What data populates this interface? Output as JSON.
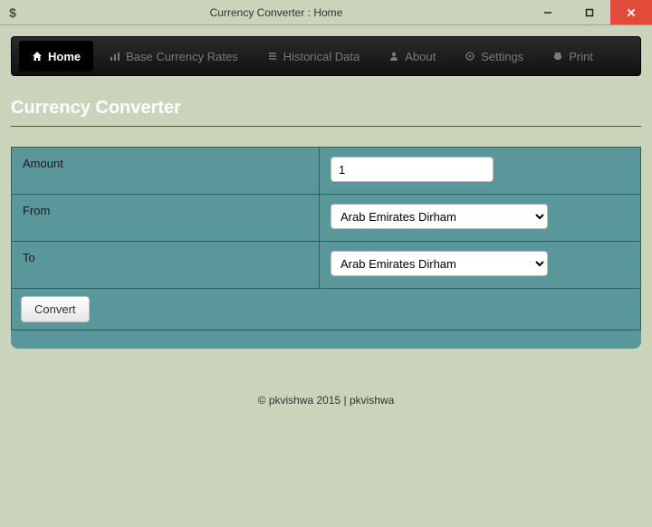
{
  "window": {
    "app_icon": "$",
    "title": "Currency Converter : Home"
  },
  "nav": {
    "items": [
      {
        "label": "Home",
        "active": true
      },
      {
        "label": "Base Currency Rates",
        "active": false
      },
      {
        "label": "Historical Data",
        "active": false
      },
      {
        "label": "About",
        "active": false
      },
      {
        "label": "Settings",
        "active": false
      },
      {
        "label": "Print",
        "active": false
      }
    ]
  },
  "page": {
    "heading": "Currency Converter"
  },
  "form": {
    "amount_label": "Amount",
    "amount_value": "1",
    "from_label": "From",
    "from_value": "Arab Emirates Dirham",
    "to_label": "To",
    "to_value": "Arab Emirates Dirham",
    "convert_label": "Convert"
  },
  "footer": {
    "text": "© pkvishwa 2015 | pkvishwa"
  }
}
